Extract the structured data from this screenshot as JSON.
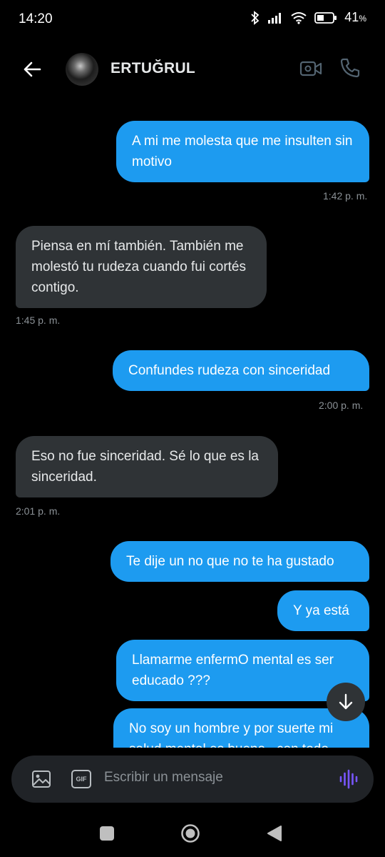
{
  "status_bar": {
    "time": "14:20",
    "battery": "41",
    "battery_unit": "%"
  },
  "header": {
    "contact_name": "ERTUĞRUL"
  },
  "messages": [
    {
      "direction": "out",
      "text": "A mi me molesta que me insulten sin motivo",
      "time": "1:42 p. m."
    },
    {
      "direction": "in",
      "text": "Piensa en mí también. También me molestó tu rudeza cuando fui cortés contigo.",
      "time": "1:45 p. m."
    },
    {
      "direction": "out",
      "text": "Confundes rudeza con sinceridad",
      "time": "2:00 p. m."
    },
    {
      "direction": "in",
      "text": "Eso no fue sinceridad. Sé lo que es la sinceridad.",
      "time": "2:01 p. m."
    },
    {
      "direction": "out",
      "text": "Te dije un no que no te ha gustado"
    },
    {
      "direction": "out",
      "text": "Y ya está"
    },
    {
      "direction": "out",
      "text": "Llamarme enfermO mental es ser educado ???"
    },
    {
      "direction": "out",
      "text": "No soy un hombre y por suerte mi salud mental es buena , con todo"
    }
  ],
  "composer": {
    "placeholder": "Escribir un mensaje",
    "gif_label": "GIF"
  },
  "colors": {
    "outgoing_bubble": "#1d9bf0",
    "incoming_bubble": "#2f3336",
    "voice_accent": "#7856ff"
  }
}
